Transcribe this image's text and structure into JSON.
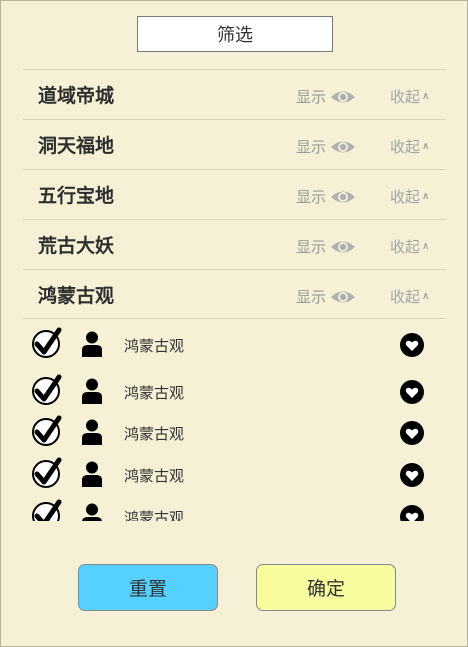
{
  "dialog": {
    "title": "筛选"
  },
  "categories": [
    {
      "name": "道域帝城",
      "show_label": "显示",
      "collapse_label": "收起"
    },
    {
      "name": "洞天福地",
      "show_label": "显示",
      "collapse_label": "收起"
    },
    {
      "name": "五行宝地",
      "show_label": "显示",
      "collapse_label": "收起"
    },
    {
      "name": "荒古大妖",
      "show_label": "显示",
      "collapse_label": "收起"
    },
    {
      "name": "鸿蒙古观",
      "show_label": "显示",
      "collapse_label": "收起"
    }
  ],
  "members": [
    {
      "name": "鸿蒙古观",
      "checked": true
    },
    {
      "name": "鸿蒙古观",
      "checked": true
    },
    {
      "name": "鸿蒙古观",
      "checked": true
    },
    {
      "name": "鸿蒙古观",
      "checked": true
    },
    {
      "name": "鸿蒙古观",
      "checked": true
    }
  ],
  "buttons": {
    "reset": "重置",
    "confirm": "确定"
  },
  "colors": {
    "panel_bg": "#f5f0d6",
    "reset_button": "#55d0ff",
    "confirm_button": "#f8fb9e"
  },
  "icons": {
    "show": "eye-icon",
    "collapse": "caret-up-icon",
    "check": "checkmark-circle-icon",
    "member": "person-icon",
    "favorite": "heart-icon"
  }
}
